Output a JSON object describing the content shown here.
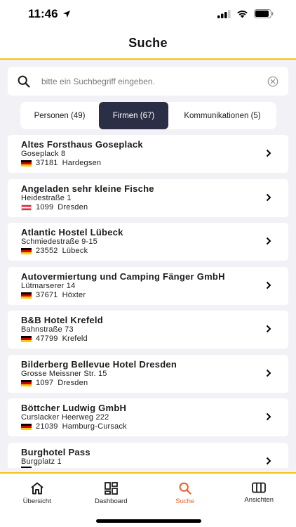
{
  "status": {
    "time": "11:46"
  },
  "header": {
    "title": "Suche"
  },
  "search": {
    "placeholder": "bitte ein Suchbegriff eingeben."
  },
  "segments": [
    {
      "label": "Personen (49)",
      "active": false
    },
    {
      "label": "Firmen (67)",
      "active": true
    },
    {
      "label": "Kommunikationen (5)",
      "active": false
    }
  ],
  "results": [
    {
      "name": "Altes Forsthaus Goseplack",
      "street": "Goseplack 8",
      "zip": "37181",
      "city": "Hardegsen",
      "country": "DE"
    },
    {
      "name": "Angeladen sehr kleine Fische",
      "street": "Heidestraße 1",
      "zip": "1099",
      "city": "Dresden",
      "country": "AT"
    },
    {
      "name": "Atlantic Hostel Lübeck",
      "street": "Schmiedestraße 9-15",
      "zip": "23552",
      "city": "Lübeck",
      "country": "DE"
    },
    {
      "name": "Autovermiertung und Camping Fänger GmbH",
      "street": "Lütmarserer 14",
      "zip": "37671",
      "city": "Höxter",
      "country": "DE"
    },
    {
      "name": "B&B Hotel Krefeld",
      "street": "Bahnstraße 73",
      "zip": "47799",
      "city": "Krefeld",
      "country": "DE"
    },
    {
      "name": "Bilderberg Bellevue Hotel Dresden",
      "street": "Grosse Meissner Str. 15",
      "zip": "1097",
      "city": "Dresden",
      "country": "DE"
    },
    {
      "name": "Böttcher Ludwig GmbH",
      "street": "Curslacker Heerweg 222",
      "zip": "21039",
      "city": "Hamburg-Cursack",
      "country": "DE"
    },
    {
      "name": "Burghotel Pass",
      "street": "Burgplatz 1",
      "zip": "",
      "city": "",
      "country": "DE"
    }
  ],
  "tabs": [
    {
      "label": "Übersicht",
      "icon": "home-icon",
      "active": false
    },
    {
      "label": "Dashboard",
      "icon": "dashboard-icon",
      "active": false
    },
    {
      "label": "Suche",
      "icon": "search-icon",
      "active": true
    },
    {
      "label": "Ansichten",
      "icon": "columns-icon",
      "active": false
    }
  ],
  "colors": {
    "accent": "#f3c316",
    "active_tab": "#e8602c",
    "segment_active": "#2b2f45"
  }
}
